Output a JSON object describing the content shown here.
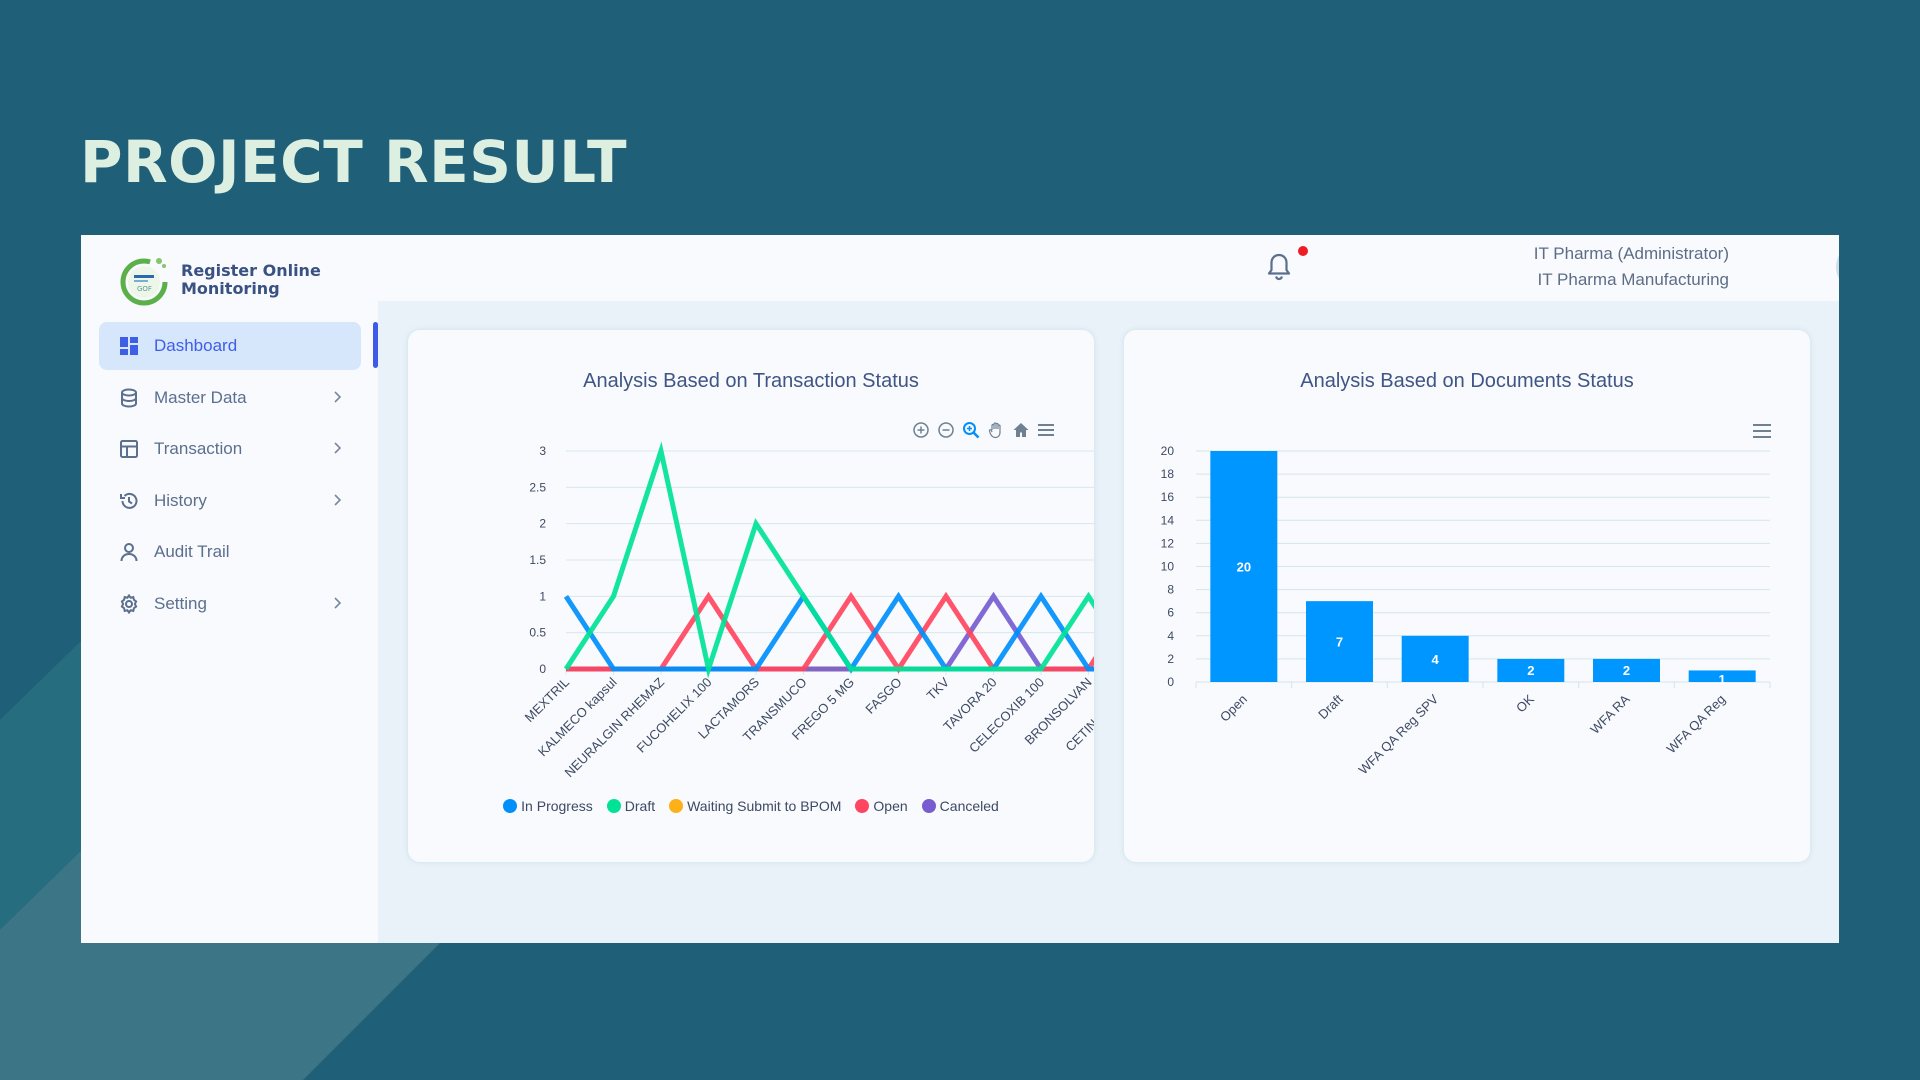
{
  "slide": {
    "title": "PROJECT RESULT"
  },
  "app": {
    "brand_line1": "Register Online",
    "brand_line2": "Monitoring",
    "logo_icon": "green-swirl-logo"
  },
  "sidebar": {
    "items": [
      {
        "label": "Dashboard",
        "icon": "dashboard-grid-icon",
        "active": true,
        "has_submenu": false
      },
      {
        "label": "Master Data",
        "icon": "database-icon",
        "active": false,
        "has_submenu": true
      },
      {
        "label": "Transaction",
        "icon": "layout-icon",
        "active": false,
        "has_submenu": true
      },
      {
        "label": "History",
        "icon": "history-icon",
        "active": false,
        "has_submenu": true
      },
      {
        "label": "Audit Trail",
        "icon": "user-icon",
        "active": false,
        "has_submenu": false
      },
      {
        "label": "Setting",
        "icon": "gear-icon",
        "active": false,
        "has_submenu": true
      }
    ]
  },
  "header": {
    "user_name": "IT Pharma (Administrator)",
    "user_company": "IT Pharma Manufacturing",
    "notification_badge": true,
    "user_status": "online"
  },
  "colors": {
    "background": "#1f5f78",
    "title": "#dcefe1",
    "accent": "#3f5ee8",
    "bar": "#0096ff"
  },
  "chart_data": [
    {
      "type": "line",
      "title": "Analysis Based on Transaction Status",
      "xlabel": "",
      "ylabel": "",
      "ylim": [
        0,
        3
      ],
      "yticks": [
        "0",
        "0.5",
        "1",
        "1.5",
        "2",
        "2.5",
        "3"
      ],
      "grid": true,
      "legend_position": "bottom",
      "toolbar": [
        "zoom-in",
        "zoom-out",
        "zoom-selection",
        "pan",
        "reset",
        "menu"
      ],
      "categories": [
        "MEXTRIL",
        "KALMECO kapsul",
        "NEURALGIN RHEMAZ",
        "FUCOHELIX 100",
        "LACTAMORS",
        "TRANSMUCO",
        "FREGO 5 MG",
        "FASGO",
        "TKV",
        "TAVORA 20",
        "CELECOXIB 100",
        "BRONSOLVAN",
        "CETINAL SIRUP"
      ],
      "series": [
        {
          "name": "In Progress",
          "color": "#008ffb",
          "values": [
            1,
            0,
            0,
            0,
            0,
            1,
            0,
            1,
            0,
            0,
            1,
            0,
            0
          ]
        },
        {
          "name": "Draft",
          "color": "#00e396",
          "values": [
            0,
            1,
            3,
            0,
            2,
            1,
            0,
            0,
            0,
            0,
            0,
            1,
            0
          ]
        },
        {
          "name": "Waiting Submit to BPOM",
          "color": "#feb019",
          "values": [
            0,
            0,
            0,
            0,
            0,
            0,
            0,
            0,
            0,
            0,
            0,
            0,
            0
          ]
        },
        {
          "name": "Open",
          "color": "#ff4560",
          "values": [
            0,
            0,
            0,
            1,
            0,
            0,
            1,
            0,
            1,
            0,
            0,
            0,
            1
          ]
        },
        {
          "name": "Canceled",
          "color": "#775dd0",
          "values": [
            0,
            0,
            0,
            0,
            0,
            0,
            0,
            0,
            0,
            1,
            0,
            0,
            0
          ]
        }
      ]
    },
    {
      "type": "bar",
      "title": "Analysis Based on Documents Status",
      "xlabel": "",
      "ylabel": "",
      "ylim": [
        0,
        20
      ],
      "yticks": [
        "0",
        "2",
        "4",
        "6",
        "8",
        "10",
        "12",
        "14",
        "16",
        "18",
        "20"
      ],
      "grid": true,
      "categories": [
        "Open",
        "Draft",
        "WFA QA Reg SPV",
        "OK",
        "WFA RA",
        "WFA QA Reg"
      ],
      "values": [
        20,
        7,
        4,
        2,
        2,
        1
      ],
      "data_labels": [
        "20",
        "7",
        "4",
        "2",
        "2",
        "1"
      ],
      "color": "#0096ff"
    }
  ]
}
